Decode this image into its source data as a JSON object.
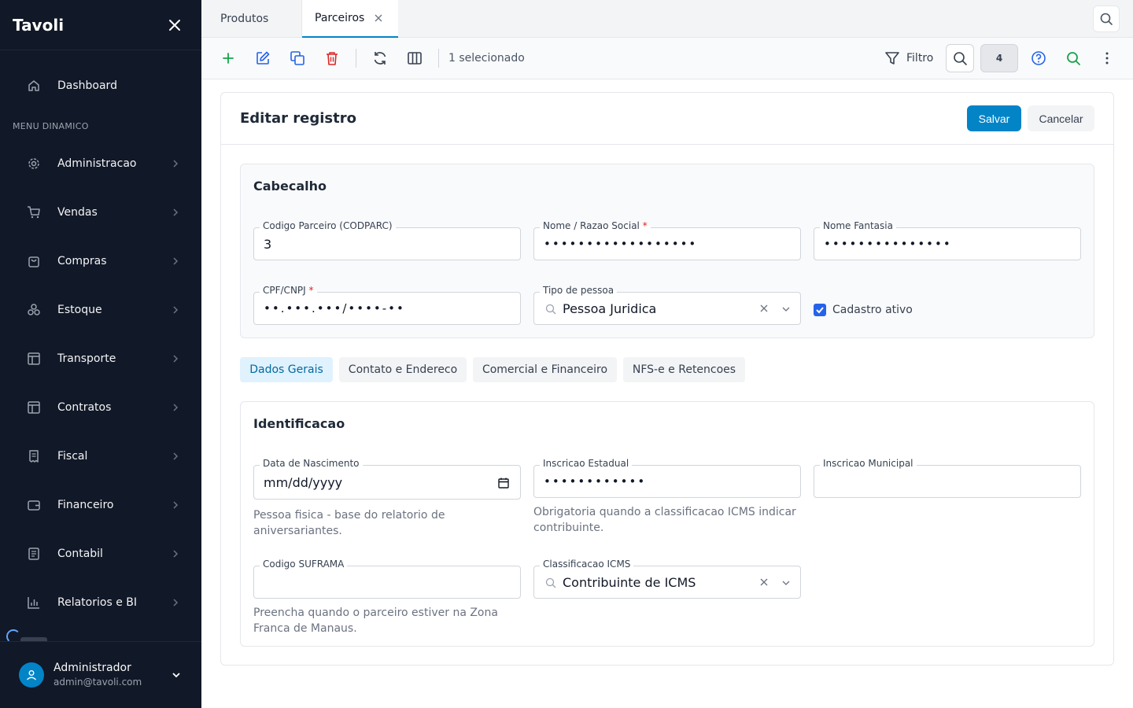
{
  "sidebar": {
    "brand": "Tavoli",
    "section_label": "MENU DINAMICO",
    "dashboard": "Dashboard",
    "items": [
      {
        "label": "Administracao",
        "icon": "gear-icon"
      },
      {
        "label": "Vendas",
        "icon": "cart-icon"
      },
      {
        "label": "Compras",
        "icon": "bag-icon"
      },
      {
        "label": "Estoque",
        "icon": "boxes-icon"
      },
      {
        "label": "Transporte",
        "icon": "layout-icon"
      },
      {
        "label": "Contratos",
        "icon": "layout-icon"
      },
      {
        "label": "Fiscal",
        "icon": "receipt-icon"
      },
      {
        "label": "Financeiro",
        "icon": "wallet-icon"
      },
      {
        "label": "Contabil",
        "icon": "book-icon"
      },
      {
        "label": "Relatorios e BI",
        "icon": "bar-chart-icon"
      }
    ],
    "user": {
      "name": "Administrador",
      "email": "admin@tavoli.com"
    }
  },
  "tabs": [
    {
      "label": "Produtos",
      "active": false
    },
    {
      "label": "Parceiros",
      "active": true
    }
  ],
  "toolbar": {
    "selected_text": "1 selecionado",
    "filter_label": "Filtro",
    "count": "4"
  },
  "form": {
    "title": "Editar registro",
    "save_label": "Salvar",
    "cancel_label": "Cancelar",
    "header_section": {
      "title": "Cabecalho",
      "codparc": {
        "label": "Codigo Parceiro (CODPARC)",
        "value": "3"
      },
      "nome": {
        "label": "Nome / Razao Social",
        "required": "*",
        "value": "••••••••••••••••••"
      },
      "fantasia": {
        "label": "Nome Fantasia",
        "value": "•••••••••••••••"
      },
      "cpf": {
        "label": "CPF/CNPJ",
        "required": "*",
        "value": "••.•••.•••/••••-••"
      },
      "tipo": {
        "label": "Tipo de pessoa",
        "value": "Pessoa Juridica"
      },
      "ativo": {
        "label": "Cadastro ativo",
        "checked": true
      }
    },
    "subtabs": [
      {
        "label": "Dados Gerais",
        "active": true
      },
      {
        "label": "Contato e Endereco",
        "active": false
      },
      {
        "label": "Comercial e Financeiro",
        "active": false
      },
      {
        "label": "NFS-e e Retencoes",
        "active": false
      }
    ],
    "ident_section": {
      "title": "Identificacao",
      "nascimento": {
        "label": "Data de Nascimento",
        "value": "mm/dd/yyyy",
        "help": "Pessoa fisica - base do relatorio de aniversariantes."
      },
      "ie": {
        "label": "Inscricao Estadual",
        "value": "••••••••••••",
        "help": "Obrigatoria quando a classificacao ICMS indicar contribuinte."
      },
      "im": {
        "label": "Inscricao Municipal",
        "value": ""
      },
      "suframa": {
        "label": "Codigo SUFRAMA",
        "value": "",
        "help": "Preencha quando o parceiro estiver na Zona Franca de Manaus."
      },
      "icms": {
        "label": "Classificacao ICMS",
        "value": "Contribuinte de ICMS"
      }
    }
  },
  "colors": {
    "sidebar_bg": "#111827",
    "primary": "#0284c7",
    "add": "#16a34a",
    "delete": "#dc2626",
    "edit": "#2563eb"
  }
}
